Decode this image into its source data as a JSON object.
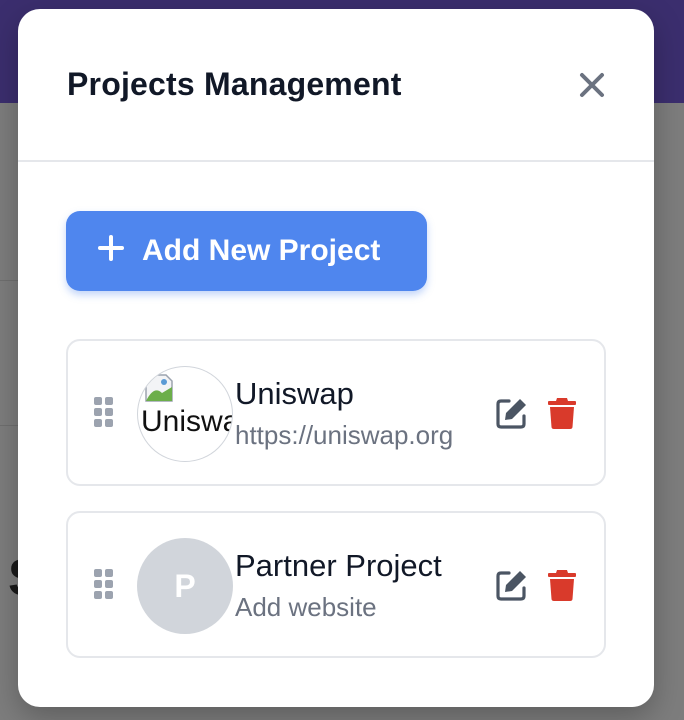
{
  "modal": {
    "title": "Projects Management",
    "add_button_label": "Add New Project"
  },
  "projects": [
    {
      "name": "Uniswap",
      "website": "https://uniswap.org",
      "logo_alt": "Uniswap",
      "logo_state": "broken-image"
    },
    {
      "name": "Partner Project",
      "website": "Add website",
      "initial": "P",
      "logo_state": "initial-placeholder"
    }
  ],
  "icons": {
    "close": "close-icon",
    "add": "plus-icon",
    "drag": "drag-handle-icon",
    "edit": "edit-icon",
    "delete": "trash-icon"
  },
  "colors": {
    "accent": "#4f86ee",
    "danger": "#d93a2b",
    "title": "#111827",
    "muted": "#6b7280",
    "icon_gray": "#4b5563",
    "placeholder_avatar": "#d1d5db"
  }
}
